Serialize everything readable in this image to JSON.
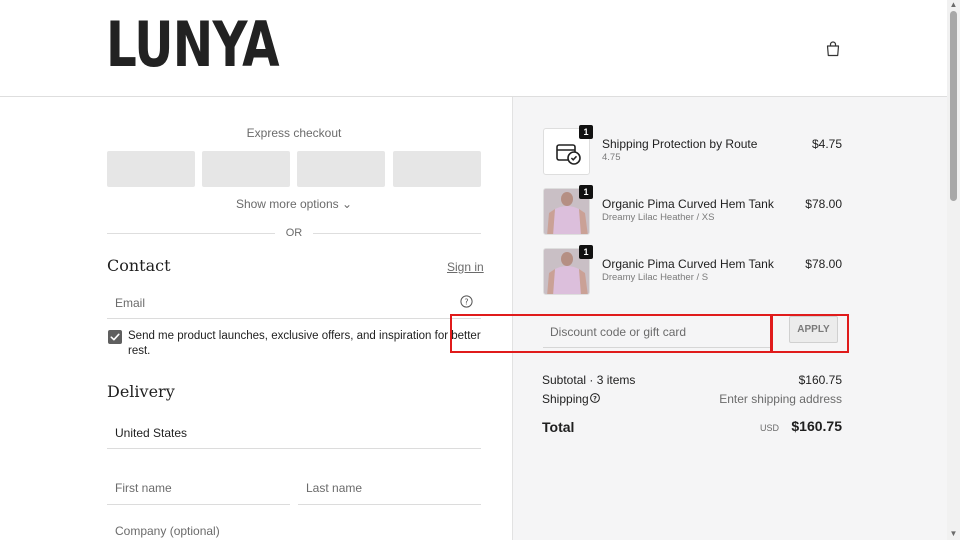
{
  "header": {
    "logo_text": "LUNYA",
    "cart_icon": "shopping-bag-icon"
  },
  "express_checkout": {
    "title": "Express checkout",
    "show_more": "Show more options ⌄",
    "or_text": "OR"
  },
  "contact": {
    "title": "Contact",
    "sign_in": "Sign in",
    "email_placeholder": "Email",
    "help_icon": "question-circle-icon",
    "marketing_checkbox_checked": true,
    "marketing_label": "Send me product launches, exclusive offers, and inspiration for better rest."
  },
  "delivery": {
    "title": "Delivery",
    "country_value": "United States",
    "first_name_placeholder": "First name",
    "last_name_placeholder": "Last name",
    "company_placeholder": "Company (optional)"
  },
  "order": {
    "items": [
      {
        "name": "Shipping Protection by Route",
        "variant": "4.75",
        "price": "$4.75",
        "qty": "1",
        "thumb_icon": "route-package-icon"
      },
      {
        "name": "Organic Pima Curved Hem Tank",
        "variant": "Dreamy Lilac Heather / XS",
        "price": "$78.00",
        "qty": "1",
        "thumb_icon": "lilac-tank-image"
      },
      {
        "name": "Organic Pima Curved Hem Tank",
        "variant": "Dreamy Lilac Heather / S",
        "price": "$78.00",
        "qty": "1",
        "thumb_icon": "lilac-tank-image"
      }
    ],
    "discount_placeholder": "Discount code or gift card",
    "apply_label": "APPLY",
    "subtotal_label": "Subtotal · 3 items",
    "subtotal_value": "$160.75",
    "shipping_label": "Shipping",
    "shipping_value": "Enter shipping address",
    "total_label": "Total",
    "total_currency": "USD",
    "total_value": "$160.75"
  },
  "colors": {
    "highlight": "#e01b1b",
    "summary_bg": "#f5f5f6",
    "express_button": "#e6e6e6",
    "product_lilac": "#d9bcd6"
  }
}
